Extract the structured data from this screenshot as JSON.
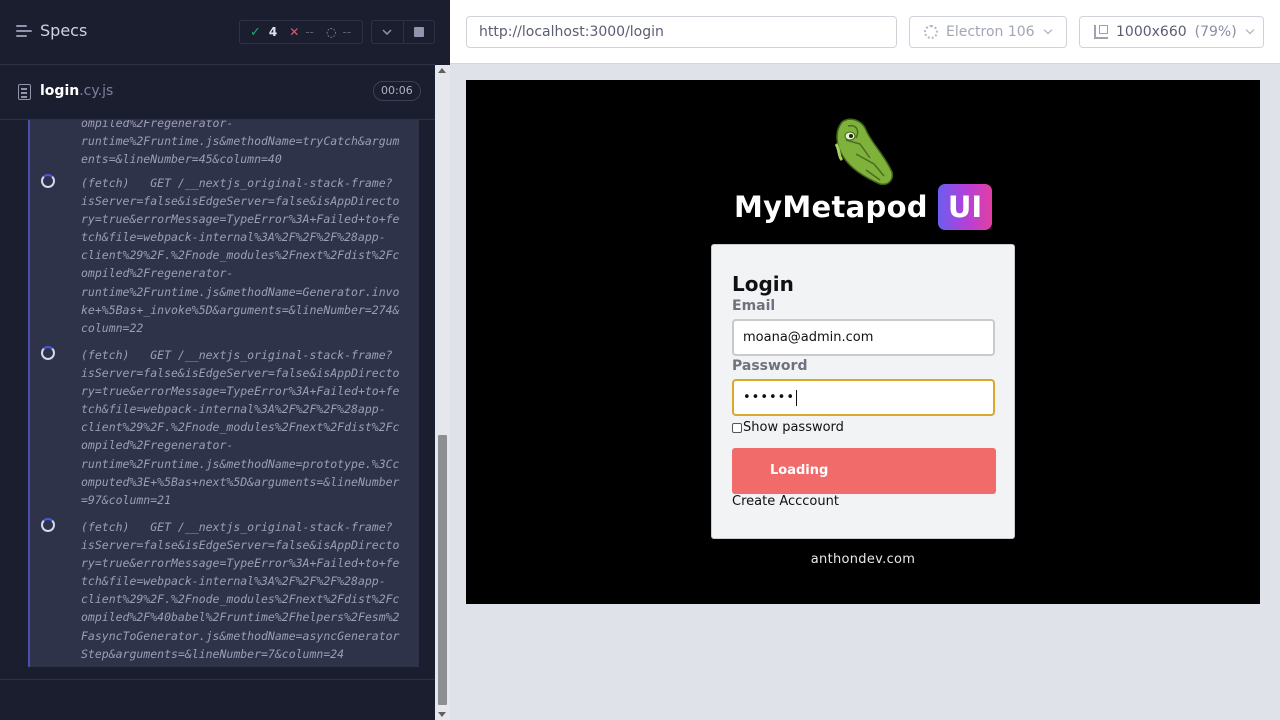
{
  "reporter": {
    "specs_label": "Specs",
    "stats": {
      "passed": "4",
      "failed": "--",
      "pending": "--"
    },
    "spec": {
      "name": "login",
      "ext": ".cy.js",
      "duration": "00:06"
    },
    "logs": [
      {
        "text": "ompiled%2Fregenerator-\nruntime%2Fruntime.js&methodName=tryCatch&argum\nents=&lineNumber=45&column=40"
      },
      {
        "text": "(fetch)   GET /__nextjs_original-stack-frame?\nisServer=false&isEdgeServer=false&isAppDirecto\nry=true&errorMessage=TypeError%3A+Failed+to+fe\ntch&file=webpack-internal%3A%2F%2F%2F%28app-\nclient%29%2F.%2Fnode_modules%2Fnext%2Fdist%2Fc\nompiled%2Fregenerator-\nruntime%2Fruntime.js&methodName=Generator.invo\nke+%5Bas+_invoke%5D&arguments=&lineNumber=274&\ncolumn=22"
      },
      {
        "text": "(fetch)   GET /__nextjs_original-stack-frame?\nisServer=false&isEdgeServer=false&isAppDirecto\nry=true&errorMessage=TypeError%3A+Failed+to+fe\ntch&file=webpack-internal%3A%2F%2F%2F%28app-\nclient%29%2F.%2Fnode_modules%2Fnext%2Fdist%2Fc\nompiled%2Fregenerator-\nruntime%2Fruntime.js&methodName=prototype.%3Cc\nomputed%3E+%5Bas+next%5D&arguments=&lineNumber\n=97&column=21"
      },
      {
        "text": "(fetch)   GET /__nextjs_original-stack-frame?\nisServer=false&isEdgeServer=false&isAppDirecto\nry=true&errorMessage=TypeError%3A+Failed+to+fe\ntch&file=webpack-internal%3A%2F%2F%2F%28app-\nclient%29%2F.%2Fnode_modules%2Fnext%2Fdist%2Fc\nompiled%2F%40babel%2Fruntime%2Fhelpers%2Fesm%2\nFasyncToGenerator.js&methodName=asyncGenerator\nStep&arguments=&lineNumber=7&column=24"
      }
    ]
  },
  "aut": {
    "url": "http://localhost:3000/login",
    "browser": "Electron 106",
    "viewport": "1000x660",
    "zoom": "(79%)"
  },
  "app": {
    "brand_name": "MyMetapod",
    "brand_badge": "UI",
    "login": {
      "title": "Login",
      "email_label": "Email",
      "email_value": "moana@admin.com",
      "password_label": "Password",
      "password_mask": "••••••",
      "show_password_label": "Show password",
      "submit_label": "Loading",
      "create_account": "Create Acccount"
    },
    "footer": "anthondev.com"
  },
  "colors": {
    "pass": "#1fa971",
    "fail": "#e45770",
    "running": "#4956e3",
    "button": "#f26b6b",
    "focus_border": "#d8a92a"
  }
}
